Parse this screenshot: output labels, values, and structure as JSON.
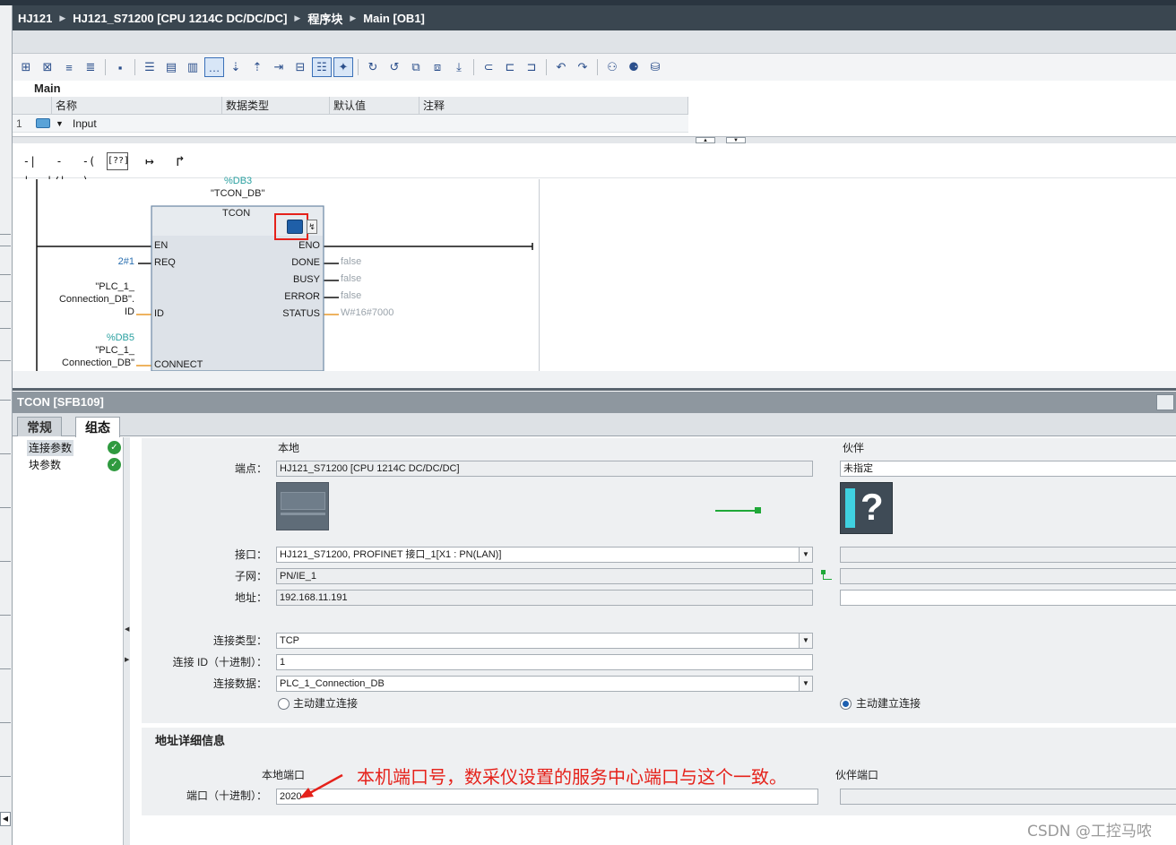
{
  "breadcrumb": [
    "HJ121",
    "HJ121_S71200 [CPU 1214C DC/DC/DC]",
    "程序块",
    "Main [OB1]"
  ],
  "toolbar_icons": [
    "insert-network-icon",
    "delete-network-icon",
    "insert-row-icon",
    "add-row-icon",
    "absolute-address-icon",
    "network-view-icon",
    "interface-icon",
    "favorites-icon",
    "comment-icon",
    "expand-icon",
    "collapse-icon",
    "go-to-icon",
    "monitor-icon",
    "call-icon",
    "open-block-icon",
    "compare-icon",
    "reset-breakpoint-icon",
    "step-icon",
    "jump-icon",
    "link-icon",
    "unlink-icon",
    "back-icon",
    "forward-icon",
    "monitoring-glasses-icon",
    "monitor-on-off-icon",
    "db-icon"
  ],
  "interface": {
    "block_name": "Main",
    "columns": [
      "名称",
      "数据类型",
      "默认值",
      "注释"
    ],
    "rows": [
      {
        "num": "1",
        "name": "Input"
      }
    ]
  },
  "lad_instructions": [
    "-| |-",
    "-|/|-",
    "-( )-",
    "[??]",
    "↦",
    "↱"
  ],
  "network": {
    "db_address": "%DB3",
    "db_name": "\"TCON_DB\"",
    "block_type": "TCON",
    "pins_left": [
      "EN",
      "REQ",
      "ID",
      "CONNECT"
    ],
    "pins_right": [
      "ENO",
      "DONE",
      "BUSY",
      "ERROR",
      "STATUS"
    ],
    "req_value": "2#1",
    "id_value_line1": "\"PLC_1_",
    "id_value_line2": "Connection_DB\".",
    "id_value_line3": "ID",
    "connect_address": "%DB5",
    "connect_line1": "\"PLC_1_",
    "connect_line2": "Connection_DB\"",
    "done_value": "false",
    "busy_value": "false",
    "error_value": "false",
    "status_value": "W#16#7000"
  },
  "inspector": {
    "title": "TCON [SFB109]",
    "tabs": [
      "常规",
      "组态"
    ],
    "active_tab": "组态",
    "nav": [
      "连接参数",
      "块参数"
    ],
    "local_header": "本地",
    "partner_header": "伙伴",
    "endpoint_label": "端点：",
    "endpoint_local": "HJ121_S71200 [CPU 1214C DC/DC/DC]",
    "endpoint_partner": "未指定",
    "interface_label": "接口：",
    "interface_local": "HJ121_S71200, PROFINET 接口_1[X1 : PN(LAN)]",
    "subnet_label": "子网：",
    "subnet_local": "PN/IE_1",
    "address_label": "地址：",
    "address_local": "192.168.11.191",
    "conn_type_label": "连接类型：",
    "conn_type": "TCP",
    "conn_id_label": "连接 ID（十进制）：",
    "conn_id": "1",
    "conn_data_label": "连接数据：",
    "conn_data": "PLC_1_Connection_DB",
    "active_conn_local": "主动建立连接",
    "active_conn_partner": "主动建立连接",
    "addr_detail_title": "地址详细信息",
    "local_port_header": "本地端口",
    "partner_port_header": "伙伴端口",
    "port_label": "端口（十进制）：",
    "port_value": "2020"
  },
  "annotation": "本机端口号，数采仪设置的服务中心端口与这个一致。",
  "watermark": "CSDN @工控马哝",
  "colors": {
    "title_bar": "#3a4650",
    "inspector_title": "#8e979f",
    "annotation": "#e5221b",
    "ok_green": "#2f9a3f",
    "wire_orange": "#e89a2c",
    "value_teal": "#2aa0a0"
  }
}
